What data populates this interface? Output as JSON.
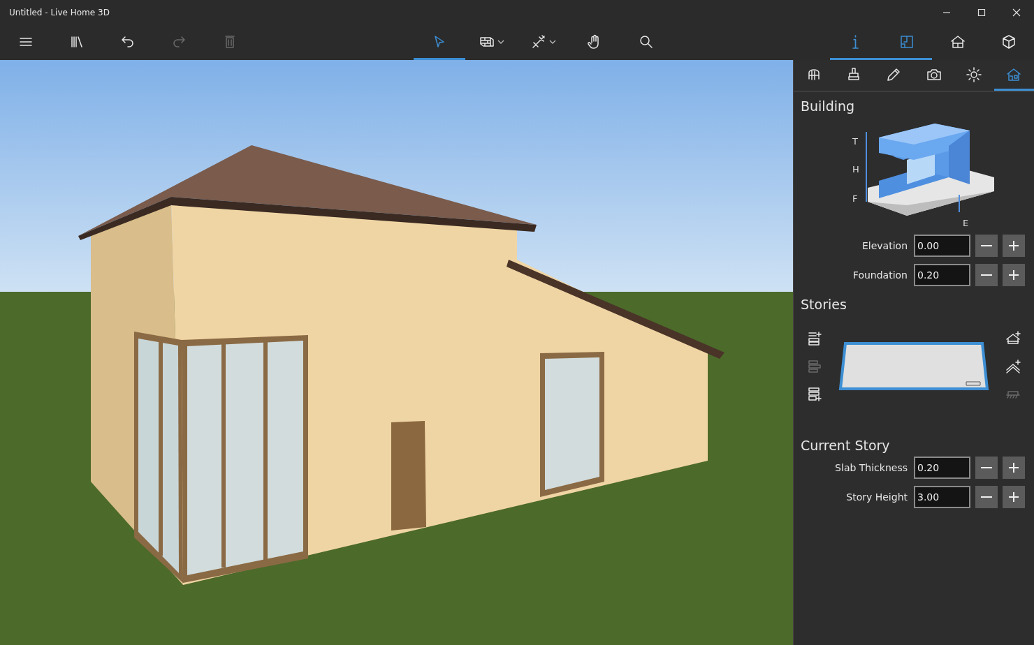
{
  "window": {
    "title": "Untitled - Live Home 3D"
  },
  "toolbar": {
    "left": [
      {
        "kind": "menu",
        "disabled": false
      },
      {
        "kind": "library",
        "disabled": false
      },
      {
        "kind": "undo",
        "disabled": false
      },
      {
        "kind": "redo",
        "disabled": true
      },
      {
        "kind": "delete",
        "disabled": true
      }
    ],
    "center": [
      {
        "kind": "select",
        "selected": true,
        "dropdown": false
      },
      {
        "kind": "wall",
        "selected": false,
        "dropdown": true
      },
      {
        "kind": "dimension",
        "selected": false,
        "dropdown": true
      },
      {
        "kind": "pan",
        "selected": false,
        "dropdown": false
      },
      {
        "kind": "search",
        "selected": false,
        "dropdown": false
      }
    ],
    "right": [
      {
        "kind": "info",
        "selected": true
      },
      {
        "kind": "plan",
        "selected": true
      },
      {
        "kind": "house",
        "selected": false
      },
      {
        "kind": "box",
        "selected": false
      }
    ]
  },
  "panel": {
    "tabs": [
      {
        "kind": "furniture",
        "selected": false
      },
      {
        "kind": "stamp",
        "selected": false
      },
      {
        "kind": "pencil",
        "selected": false
      },
      {
        "kind": "camera",
        "selected": false
      },
      {
        "kind": "sun",
        "selected": false
      },
      {
        "kind": "building",
        "selected": true
      }
    ],
    "building": {
      "title": "Building",
      "diagram_labels": [
        "T",
        "H",
        "F",
        "E"
      ],
      "fields": [
        {
          "label": "Elevation",
          "value": "0.00"
        },
        {
          "label": "Foundation",
          "value": "0.20"
        }
      ]
    },
    "stories": {
      "title": "Stories",
      "story_selected": true,
      "left_tools": [
        {
          "kind": "add-above",
          "disabled": false
        },
        {
          "kind": "remove",
          "disabled": true
        },
        {
          "kind": "add-below",
          "disabled": false
        }
      ],
      "right_tools": [
        {
          "kind": "add-roof",
          "disabled": false
        },
        {
          "kind": "add-attic",
          "disabled": false
        },
        {
          "kind": "ground",
          "disabled": true
        }
      ]
    },
    "current_story": {
      "title": "Current Story",
      "fields": [
        {
          "label": "Slab Thickness",
          "value": "0.20"
        },
        {
          "label": "Story Height",
          "value": "3.00"
        }
      ]
    }
  }
}
